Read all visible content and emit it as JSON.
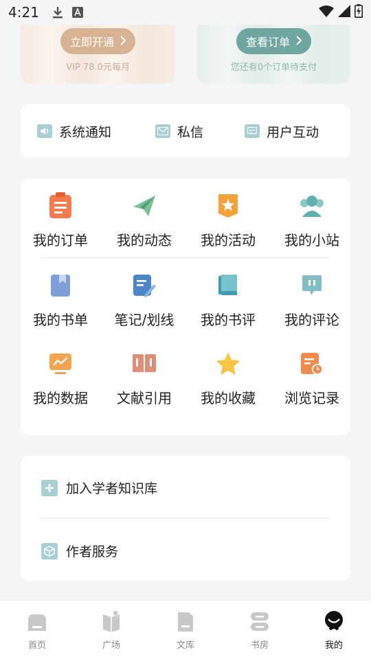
{
  "status_bar": {
    "time": "4:21",
    "icons": [
      "download-icon",
      "keyboard-a-icon",
      "wifi-icon",
      "signal-icon",
      "battery-charging-icon"
    ]
  },
  "promo": {
    "vip": {
      "button_label": "立即开通",
      "subtitle": "VIP 78.0元每月"
    },
    "order": {
      "button_label": "查看订单",
      "subtitle": "您还有0个订单待支付"
    }
  },
  "notifications": [
    {
      "label": "系统通知",
      "icon": "speaker-icon"
    },
    {
      "label": "私信",
      "icon": "mail-icon"
    },
    {
      "label": "用户互动",
      "icon": "chat-icon"
    }
  ],
  "grid": {
    "rows": [
      [
        {
          "label": "我的订单",
          "icon": "order-list-icon"
        },
        {
          "label": "我的动态",
          "icon": "paper-plane-icon"
        },
        {
          "label": "我的活动",
          "icon": "star-badge-icon"
        },
        {
          "label": "我的小站",
          "icon": "community-icon"
        }
      ],
      [
        {
          "label": "我的书单",
          "icon": "bookmark-book-icon"
        },
        {
          "label": "笔记/划线",
          "icon": "note-pen-icon"
        },
        {
          "label": "我的书评",
          "icon": "book-review-icon"
        },
        {
          "label": "我的评论",
          "icon": "comment-bubble-icon"
        }
      ],
      [
        {
          "label": "我的数据",
          "icon": "chart-monitor-icon"
        },
        {
          "label": "文献引用",
          "icon": "open-book-icon"
        },
        {
          "label": "我的收藏",
          "icon": "star-icon"
        },
        {
          "label": "浏览记录",
          "icon": "history-clock-icon"
        }
      ]
    ]
  },
  "list": [
    {
      "label": "加入学者知识库",
      "icon": "plus-icon"
    },
    {
      "label": "作者服务",
      "icon": "cube-icon"
    }
  ],
  "tabs": [
    {
      "label": "首页",
      "icon": "home-icon",
      "active": false
    },
    {
      "label": "广场",
      "icon": "square-icon",
      "active": false
    },
    {
      "label": "文库",
      "icon": "library-icon",
      "active": false
    },
    {
      "label": "书房",
      "icon": "study-icon",
      "active": false
    },
    {
      "label": "我的",
      "icon": "profile-icon",
      "active": true
    }
  ],
  "colors": {
    "vip_button": "#d8b393",
    "order_button": "#6fa69f",
    "icon_teal": "#a9cfd4",
    "tab_inactive": "#c8c8c8",
    "tab_active": "#111111"
  }
}
